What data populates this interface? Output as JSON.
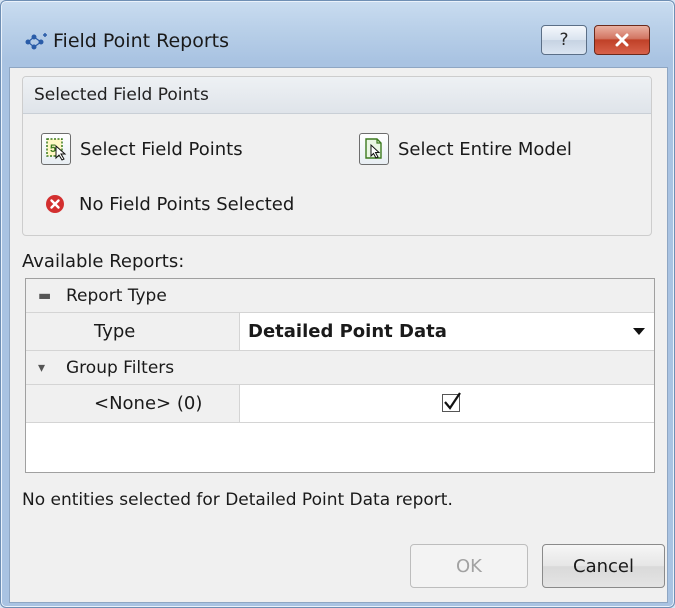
{
  "window": {
    "title": "Field Point Reports",
    "help_label": "?",
    "accent": "#c04128"
  },
  "selected_group": {
    "title": "Selected Field Points",
    "select_field_points_label": "Select Field Points",
    "select_entire_model_label": "Select Entire Model",
    "status_text": "No Field Points Selected",
    "status_color": "#d32f2f"
  },
  "reports": {
    "label": "Available Reports:",
    "categories": [
      {
        "label": "Report Type",
        "properties": [
          {
            "name": "Type",
            "value": "Detailed Point Data",
            "editor": "dropdown"
          }
        ]
      },
      {
        "label": "Group Filters",
        "properties": [
          {
            "name": "<None>  (0)",
            "value": true,
            "editor": "checkbox"
          }
        ]
      }
    ]
  },
  "info_text": "No entities selected for Detailed Point Data report.",
  "buttons": {
    "ok": "OK",
    "cancel": "Cancel"
  },
  "icons": [
    "field-point-reports-icon",
    "help-icon",
    "close-icon",
    "select-field-points-icon",
    "select-entire-model-icon",
    "error-icon",
    "expand-toggle-icon",
    "dropdown-arrow-icon",
    "checkmark-icon"
  ]
}
